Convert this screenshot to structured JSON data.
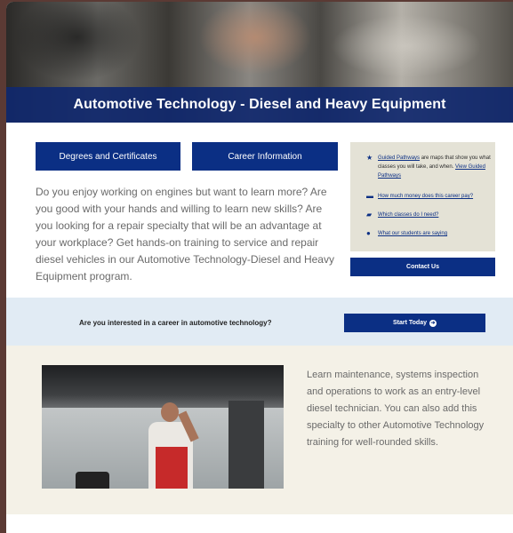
{
  "hero": {
    "title": "Automotive Technology - Diesel and Heavy Equipment"
  },
  "buttons": {
    "degrees": "Degrees and Certificates",
    "career": "Career Information"
  },
  "intro": "Do you enjoy working on engines but want to learn more? Are you good with your hands and willing to learn new skills? Are you looking for a repair specialty that will be an advantage at your workplace? Get hands-on training to service and repair diesel vehicles in our Automotive Technology-Diesel and Heavy Equipment program.",
  "sidebar": {
    "pathways": {
      "link": "Guided Pathways",
      "text_1": " are maps that show you what classes you will take, and when. ",
      "link_2": "View Guided Pathways",
      "icon": "star-icon"
    },
    "money": {
      "link": "How much money does this career pay?",
      "icon": "money-icon"
    },
    "classes": {
      "link": "Which classes do I need?",
      "icon": "book-icon"
    },
    "students": {
      "link": "What our students are saying",
      "icon": "person-icon"
    },
    "contact": "Contact Us"
  },
  "banner": {
    "question": "Are you interested in a career in automotive technology?",
    "start": "Start Today",
    "start_icon": "arrow-circle-right-icon"
  },
  "bottom": {
    "text": "Learn maintenance, systems inspection and operations to work as an entry-level diesel technician. You can also add this specialty to other Automotive Technology training for well-rounded skills."
  },
  "colors": {
    "brand_blue": "#0b2f84",
    "banner_bg": "#e1ebf4",
    "section_bg": "#f4f1e7",
    "sidebar_bg": "#e4e2d6"
  }
}
